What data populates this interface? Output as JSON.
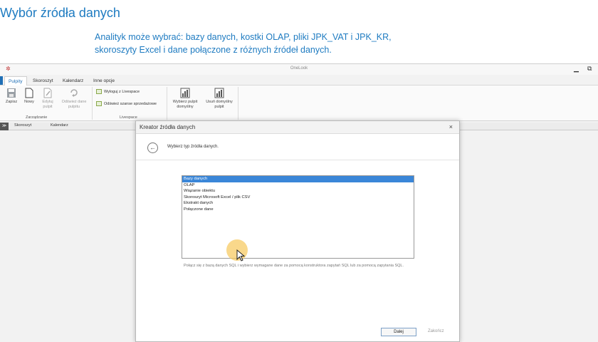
{
  "slide": {
    "title": "Wybór źródła danych",
    "description_line1": "Analityk może wybrać: bazy danych, kostki OLAP, pliki JPK_VAT i JPK_KR,",
    "description_line2": "skoroszyty Excel i dane połączone z różnych źródeł danych."
  },
  "app": {
    "title": "OneLook",
    "icon": "app-logo-icon",
    "window_buttons": [
      "▁",
      "⧉"
    ]
  },
  "ribbon": {
    "tabs": [
      {
        "label": "Pulpity",
        "active": true
      },
      {
        "label": "Skoroszyt",
        "active": false
      },
      {
        "label": "Kalendarz",
        "active": false
      },
      {
        "label": "Inne opcje",
        "active": false
      }
    ],
    "buttons": {
      "save": "Zapisz",
      "new": "Nowy",
      "edit_l1": "Edytuj",
      "edit_l2": "pulpit",
      "refresh_l1": "Odśwież dane",
      "refresh_l2": "pulpitu",
      "logout": "Wyloguj z Livespace",
      "refresh_chances": "Odśwież szanse sprzedażowe",
      "choose_default_l1": "Wybierz pulpit",
      "choose_default_l2": "domyślny",
      "remove_default_l1": "Usuń domyślny",
      "remove_default_l2": "pulpit"
    },
    "groups": {
      "management": "Zarządzanie",
      "livespace": "Livespace"
    }
  },
  "doc_tabs": [
    "Skoroszyt",
    "Kalendarz"
  ],
  "dialog": {
    "title": "Kreator źródła danych",
    "close": "×",
    "step_text": "Wybierz typ źródła danych.",
    "options": [
      {
        "label": "Bazy danych",
        "selected": true
      },
      {
        "label": "OLAP",
        "selected": false
      },
      {
        "label": "Wiązanie obiektu",
        "selected": false
      },
      {
        "label": "Skoroszyt Microsoft Excel / plik CSV",
        "selected": false
      },
      {
        "label": "Ekstrakt danych",
        "selected": false
      },
      {
        "label": "Połączone dane",
        "selected": false
      }
    ],
    "hint": "Połącz się z bazą danych SQL i wybierz wymagane dane za pomocą konstruktora zapytań SQL lub za pomocą zapytania SQL.",
    "next": "Dalej",
    "finish": "Zakończ"
  },
  "colors": {
    "slide_text": "#1e7bc1",
    "accent": "#1f6fb6",
    "selection": "#3a86d8",
    "cursor_halo": "#f7c85a"
  }
}
